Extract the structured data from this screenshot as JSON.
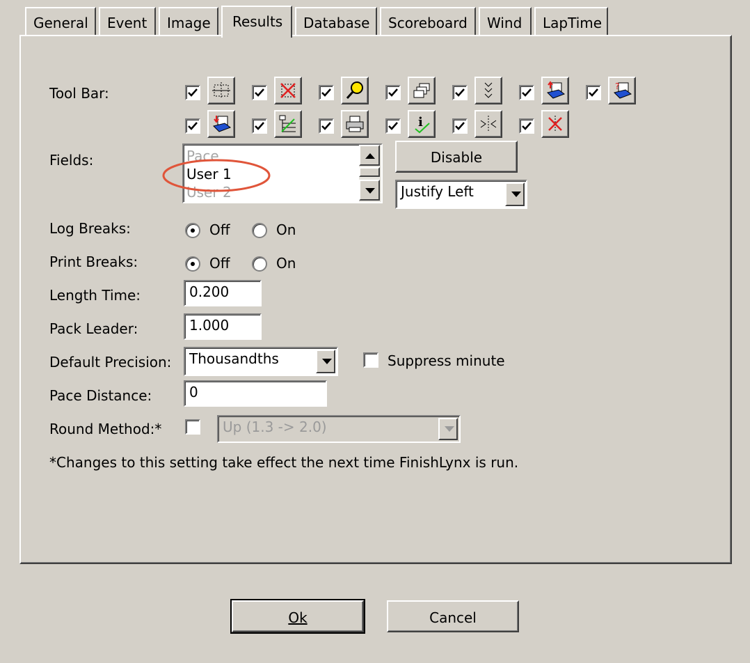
{
  "tabs": [
    "General",
    "Event",
    "Image",
    "Results",
    "Database",
    "Scoreboard",
    "Wind",
    "LapTime"
  ],
  "active_tab": "Results",
  "toolbar": {
    "label": "Tool Bar:",
    "icons_row1": [
      "split-screen-icon",
      "delete-icon",
      "magnifier-icon",
      "stacked-windows-icon",
      "check-list-icon",
      "upload-database-icon",
      "help-database-icon"
    ],
    "icons_row2": [
      "download-database-icon",
      "step-process-icon",
      "printer-icon",
      "info-check-icon",
      "expand-icon",
      "cut-icon"
    ],
    "all_checked": true
  },
  "fields": {
    "label": "Fields:",
    "items": [
      "Pace",
      "User 1",
      "User 2"
    ],
    "selected": "User 1",
    "disable_button": "Disable",
    "justify": "Justify Left",
    "highlight_color": "#e0553a"
  },
  "log_breaks": {
    "label": "Log Breaks:",
    "off": "Off",
    "on": "On",
    "value": "Off"
  },
  "print_breaks": {
    "label": "Print Breaks:",
    "off": "Off",
    "on": "On",
    "value": "Off"
  },
  "length_time": {
    "label": "Length Time:",
    "value": "0.200"
  },
  "pack_leader": {
    "label": "Pack Leader:",
    "value": "1.000"
  },
  "default_precision": {
    "label": "Default Precision:",
    "value": "Thousandths",
    "suppress_label": "Suppress minute",
    "suppress_checked": false
  },
  "pace_distance": {
    "label": "Pace Distance:",
    "value": "0"
  },
  "round_method": {
    "label": "Round Method:*",
    "checked": false,
    "value": "Up  (1.3 -> 2.0)"
  },
  "note": "*Changes to this setting take effect the next time FinishLynx is run.",
  "buttons": {
    "ok": "Ok",
    "cancel": "Cancel"
  }
}
